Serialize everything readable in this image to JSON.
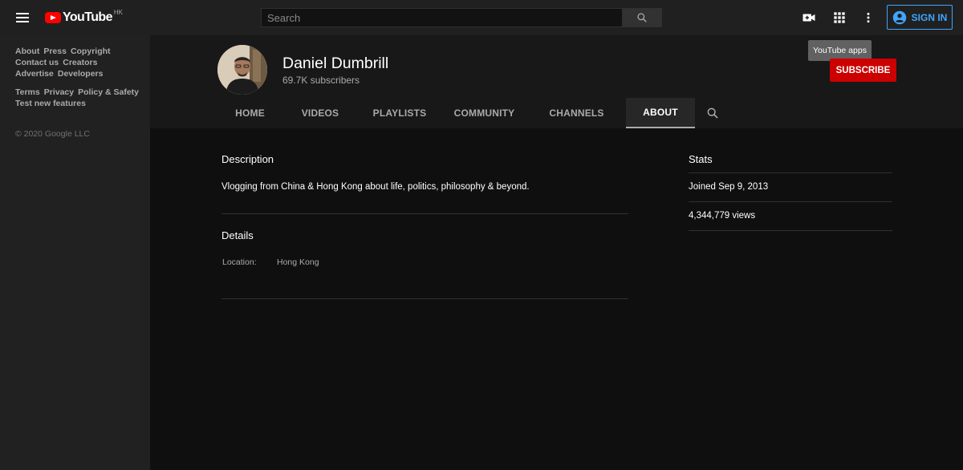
{
  "header": {
    "logo_text": "YouTube",
    "region": "HK",
    "search_placeholder": "Search",
    "signin_label": "SIGN IN",
    "tooltip": "YouTube apps"
  },
  "sidebar": {
    "links_row1": [
      "About",
      "Press",
      "Copyright",
      "Contact us",
      "Creators",
      "Advertise",
      "Developers"
    ],
    "links_row2": [
      "Terms",
      "Privacy",
      "Policy & Safety",
      "Test new features"
    ],
    "copyright": "© 2020 Google LLC"
  },
  "channel": {
    "name": "Daniel Dumbrill",
    "subscribers": "69.7K subscribers",
    "subscribe_label": "SUBSCRIBE"
  },
  "tabs": [
    {
      "label": "HOME",
      "active": false
    },
    {
      "label": "VIDEOS",
      "active": false
    },
    {
      "label": "PLAYLISTS",
      "active": false
    },
    {
      "label": "COMMUNITY",
      "active": false
    },
    {
      "label": "CHANNELS",
      "active": false
    },
    {
      "label": "ABOUT",
      "active": true
    }
  ],
  "about": {
    "description_title": "Description",
    "description_text": "Vlogging from China & Hong Kong about life, politics, philosophy & beyond.",
    "details_title": "Details",
    "location_label": "Location:",
    "location_value": "Hong Kong",
    "stats_title": "Stats",
    "joined": "Joined Sep 9, 2013",
    "views": "4,344,779 views"
  },
  "colors": {
    "accent_blue": "#3ea6ff",
    "subscribe_red": "#cc0000",
    "logo_red": "#ff0000"
  },
  "icons": {
    "menu": "hamburger-menu-icon",
    "search": "search-icon",
    "create": "video-camera-icon",
    "apps": "apps-grid-icon",
    "more": "more-vertical-icon",
    "account": "account-circle-icon"
  }
}
